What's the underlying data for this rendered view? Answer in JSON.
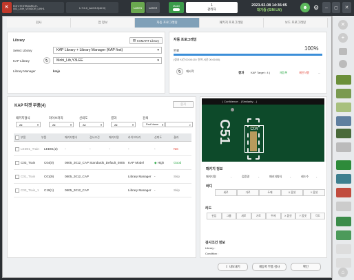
{
  "topbar": {
    "board_name": "KOH-TESTBOARD-H-003_LINH_VENDOR_LINH1",
    "version": "1.7.6.0_ALG3.3(42.0)",
    "lane1": "Lane1",
    "lane2": "Lane2",
    "model": "Model",
    "counter": "1",
    "role": "관리자",
    "datetime": "2023-02-08 14:36:05",
    "status": "대기중 (SIM LM)"
  },
  "steps": [
    "검사",
    "잡 정보",
    "자동 프로그래밍",
    "패키지 프로그래밍",
    "보드 프로그래밍"
  ],
  "library": {
    "title": "Library",
    "kmart_button": "KSMART Library",
    "select_label": "Select Library",
    "select_value": "KAP Library + Library Manager (KAP first)",
    "kap_label": "KAP Library",
    "kap_value": "Mobi_Lib,Y3LEE",
    "manager_label": "Library Manager",
    "manager_value": "kmjs"
  },
  "auto_prog": {
    "title": "자동 프로그래밍",
    "progress_label": "완료",
    "progress_percent": 100,
    "progress_text": "100%",
    "time_text": "(경과 시간 00:00:15 / 잔여 시간 00:00:00)",
    "retry_label": "재시작",
    "result_label": "결과",
    "kap_target": "KAP Target : 4 (",
    "r1": "재등록",
    "r2": "재인식행",
    "r3": "...",
    "stop_button": "중지"
  },
  "kap_target": {
    "title": "KAP 타겟 부품(4)",
    "filters": [
      {
        "label": "패키지형식",
        "value": "All"
      },
      {
        "label": "라이브러리",
        "value": "All"
      },
      {
        "label": "신뢰도",
        "value": "All"
      },
      {
        "label": "결과",
        "value": "All"
      },
      {
        "label": "검색",
        "value": "Part Name"
      }
    ],
    "columns": [
      "부품",
      "부품",
      "패키지형식",
      "검사조건",
      "패키지명",
      "라이브러리",
      "신뢰도",
      "결과"
    ],
    "rows": [
      {
        "name": "LED01_Train",
        "part": "LED01(2)",
        "pkg": "-",
        "cond": "-",
        "pkgname": "-",
        "lib": "-",
        "conf": "-",
        "result": "NG"
      },
      {
        "name": "C03_Train",
        "part": "C04(0)",
        "pkg": "0805_2012_CAP Standards_Default_0805",
        "cond": "",
        "pkgname": "KAP Model",
        "lib": "",
        "conf": "High",
        "result": "Good"
      },
      {
        "name": "C01_Train",
        "part": "C01(9)",
        "pkg": "0805_2012_CAP",
        "cond": "",
        "pkgname": "Library Manager",
        "lib": "",
        "conf": "-",
        "result": "Skip"
      },
      {
        "name": "C03_Train_1",
        "part": "C19(1)",
        "pkg": "0805_2012_CAP",
        "cond": "",
        "pkgname": "Library Manager",
        "lib": "",
        "conf": "-",
        "result": "Skip"
      }
    ]
  },
  "preview": {
    "header": "| Confidence: - |Similarity: - |",
    "marking": "C51",
    "chip_label": "C04"
  },
  "pkg_info": {
    "title": "패키지 정보",
    "items": [
      "패키지명",
      "-",
      "검증명",
      "-",
      "패키지형식",
      "-",
      "레드수",
      "-"
    ],
    "body_title": "바디",
    "body_cols": [
      "세로",
      "가로",
      "두께",
      "X 옵셋",
      "Y 옵셋"
    ],
    "lead_title": "리드",
    "lead_cols": [
      "핀입",
      "그룹",
      "세로",
      "가로",
      "두께",
      "X 옵셋",
      "Y 옵셋",
      "각도"
    ],
    "cond_title": "검사조건 정보",
    "cond_library": "Library :",
    "cond_condition": "Condition :"
  },
  "footer": {
    "export": "내보내기",
    "reinspect": "재등록 부품 검사",
    "ok": "확인"
  },
  "colors": {
    "ng": "#e0392b",
    "good": "#2aa845",
    "skip": "#888888",
    "accent": "#7fa0b8",
    "progress": "#3b8ed8"
  }
}
